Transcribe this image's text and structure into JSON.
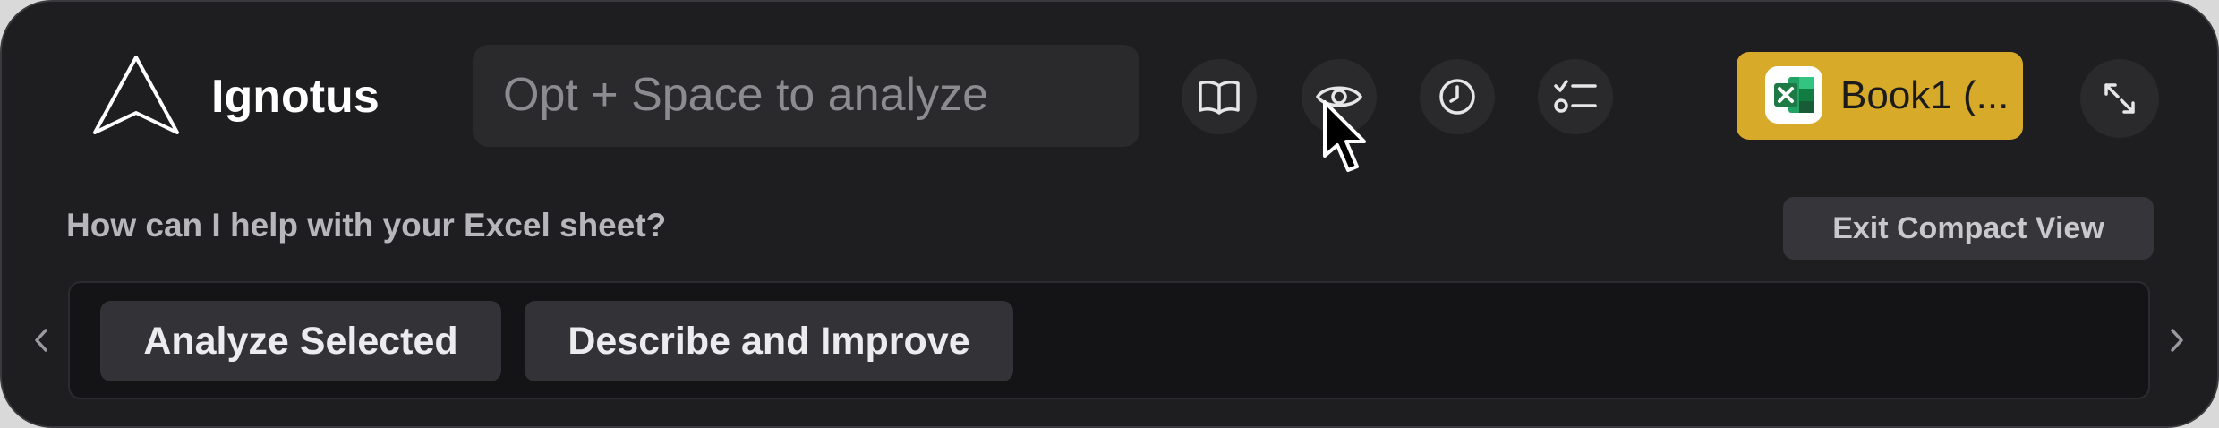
{
  "app": {
    "name": "Ignotus"
  },
  "search": {
    "placeholder": "Opt + Space to analyze"
  },
  "toolbar": {
    "icons": [
      "book-icon",
      "eye-icon",
      "clock-icon",
      "checklist-icon"
    ]
  },
  "file": {
    "name": "Book1 (...",
    "icon": "excel-icon"
  },
  "prompt": {
    "text": "How can I help with your Excel sheet?"
  },
  "actions": {
    "exit_compact_label": "Exit Compact View"
  },
  "suggestions": [
    {
      "label": "Analyze Selected"
    },
    {
      "label": "Describe and Improve"
    }
  ],
  "colors": {
    "panel": "#1e1e21",
    "accent": "#d8aa2a",
    "excel_green": "#1d7a45"
  }
}
